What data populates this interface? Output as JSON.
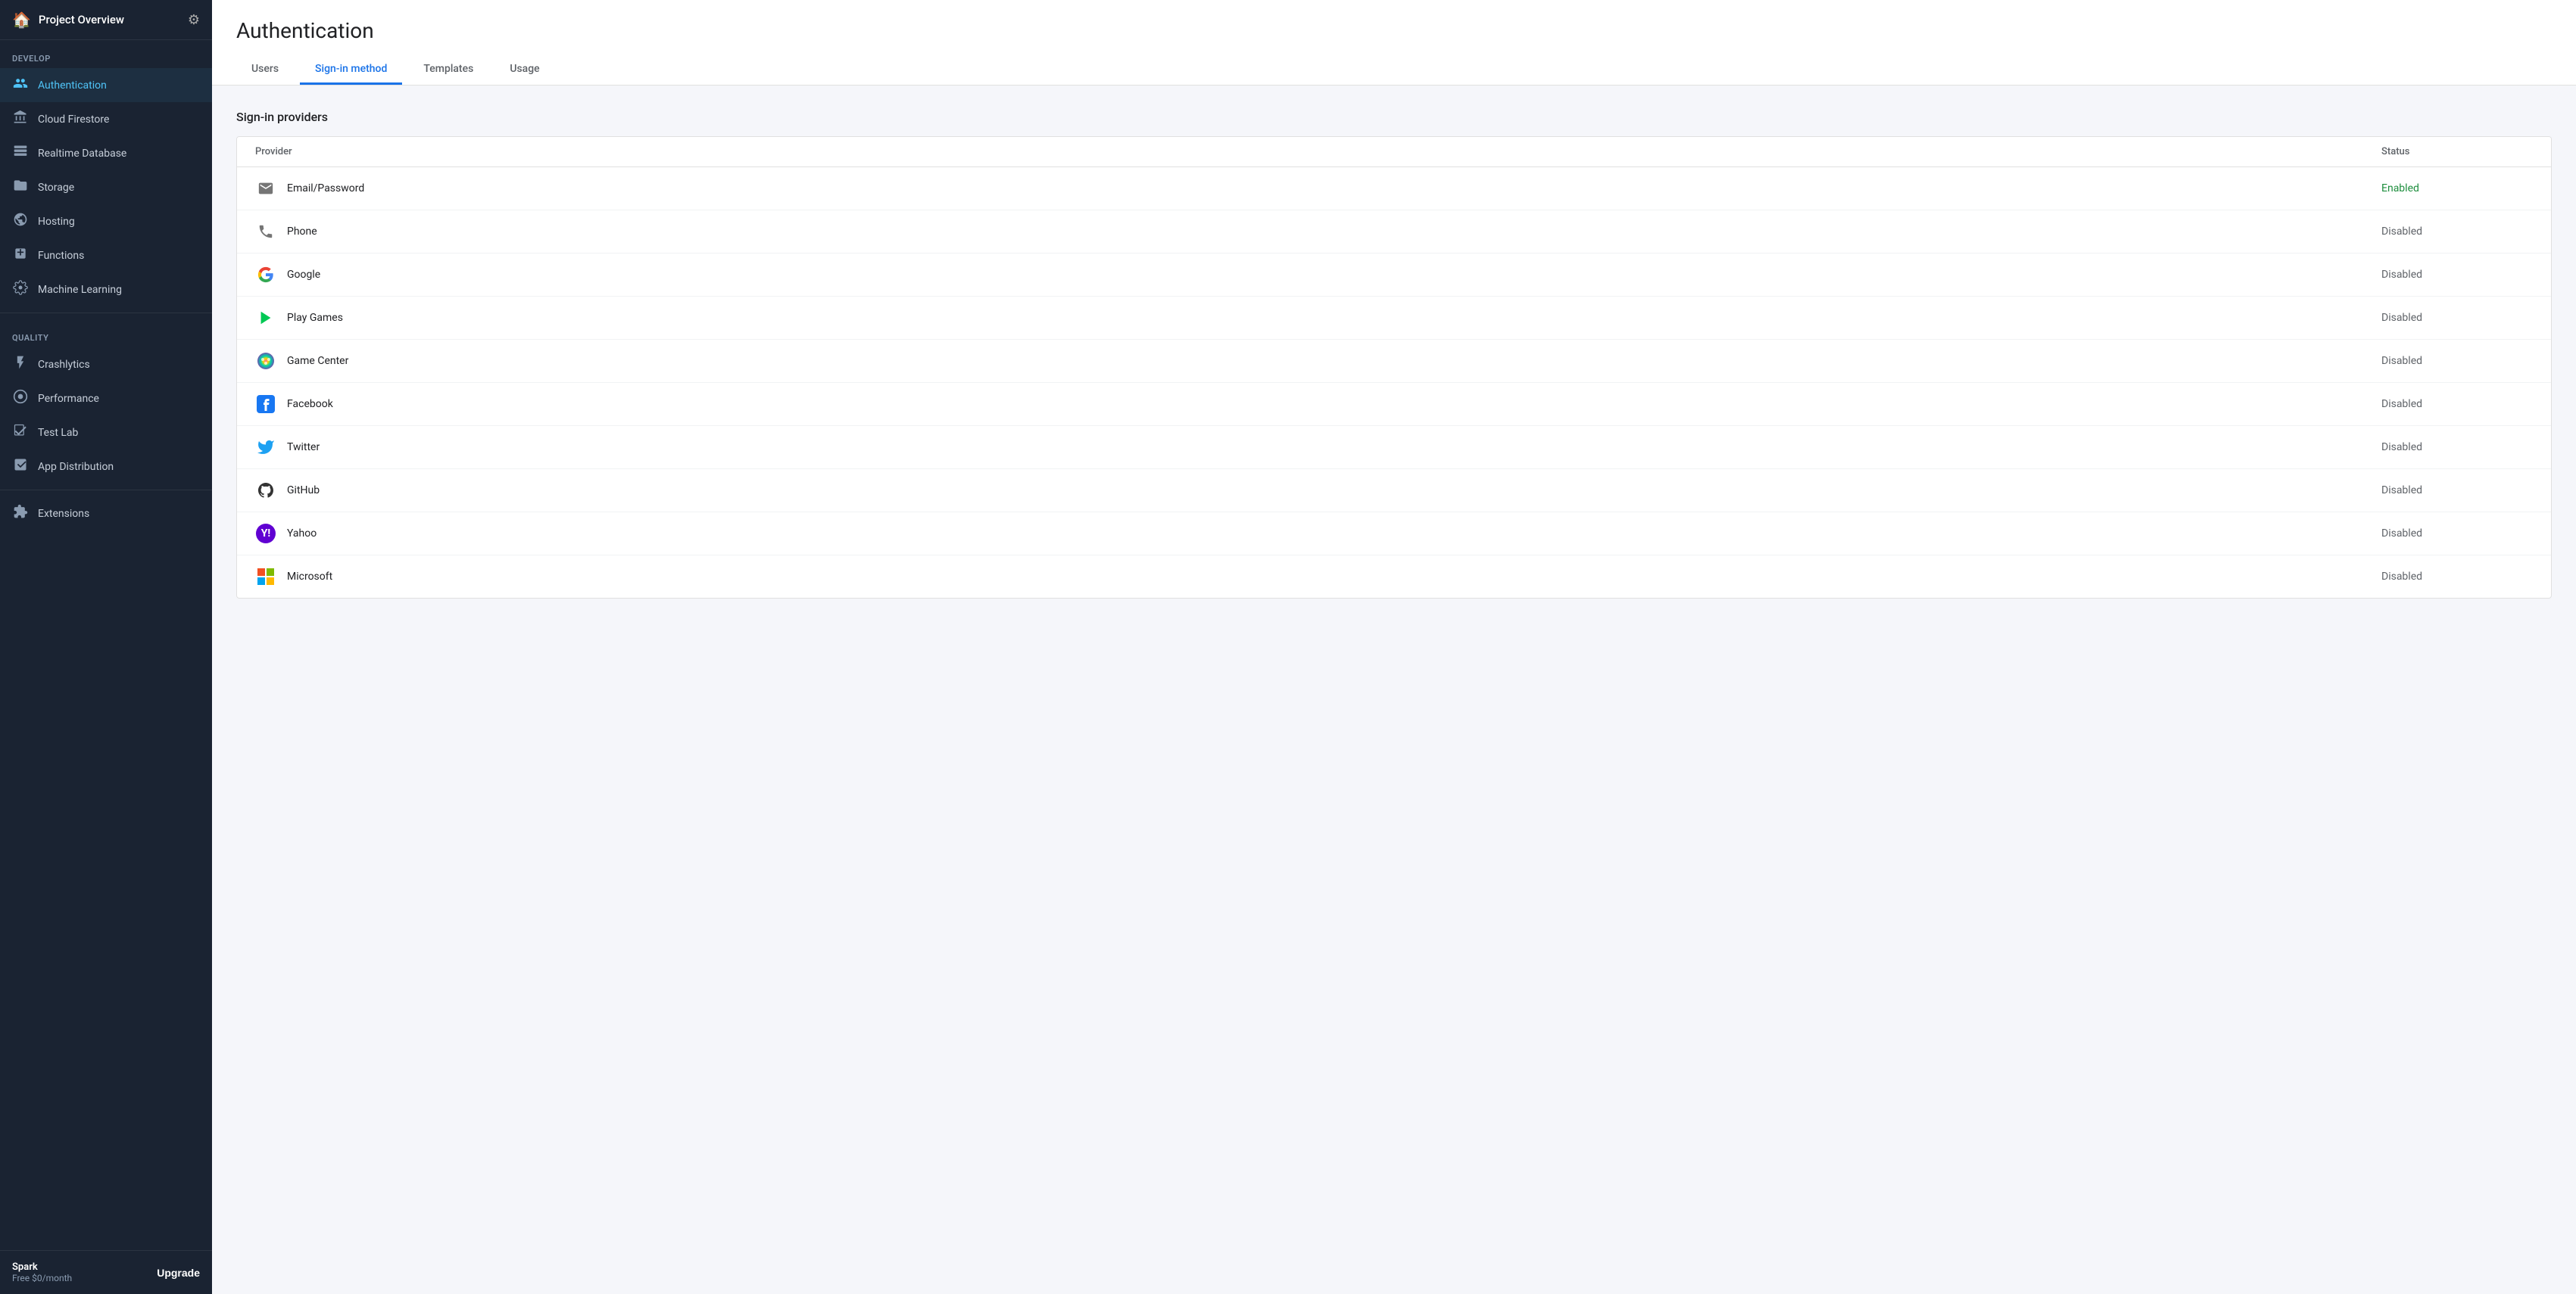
{
  "sidebar": {
    "header": {
      "home_label": "Project Overview",
      "gear_label": "⚙"
    },
    "develop": {
      "section_label": "Develop",
      "items": [
        {
          "id": "authentication",
          "label": "Authentication",
          "icon": "👥",
          "active": true
        },
        {
          "id": "cloud-firestore",
          "label": "Cloud Firestore",
          "icon": "🔥"
        },
        {
          "id": "realtime-database",
          "label": "Realtime Database",
          "icon": "🖥"
        },
        {
          "id": "storage",
          "label": "Storage",
          "icon": "🖼"
        },
        {
          "id": "hosting",
          "label": "Hosting",
          "icon": "🌐"
        },
        {
          "id": "functions",
          "label": "Functions",
          "icon": "⚙"
        },
        {
          "id": "machine-learning",
          "label": "Machine Learning",
          "icon": "🤖"
        }
      ]
    },
    "quality": {
      "section_label": "Quality",
      "items": [
        {
          "id": "crashlytics",
          "label": "Crashlytics",
          "icon": "⚡"
        },
        {
          "id": "performance",
          "label": "Performance",
          "icon": "🔘"
        },
        {
          "id": "test-lab",
          "label": "Test Lab",
          "icon": "✅"
        },
        {
          "id": "app-distribution",
          "label": "App Distribution",
          "icon": "📋"
        }
      ]
    },
    "extensions": {
      "label": "Extensions",
      "icon": "🧩"
    },
    "footer": {
      "plan_name": "Spark",
      "plan_price": "Free $0/month",
      "upgrade_label": "Upgrade"
    }
  },
  "header": {
    "page_title": "Authentication",
    "tabs": [
      {
        "id": "users",
        "label": "Users",
        "active": false
      },
      {
        "id": "sign-in-method",
        "label": "Sign-in method",
        "active": true
      },
      {
        "id": "templates",
        "label": "Templates",
        "active": false
      },
      {
        "id": "usage",
        "label": "Usage",
        "active": false
      }
    ]
  },
  "content": {
    "section_title": "Sign-in providers",
    "table": {
      "columns": [
        {
          "id": "provider",
          "label": "Provider"
        },
        {
          "id": "status",
          "label": "Status"
        }
      ],
      "rows": [
        {
          "id": "email-password",
          "provider": "Email/Password",
          "icon_type": "email",
          "status": "Enabled",
          "enabled": true
        },
        {
          "id": "phone",
          "provider": "Phone",
          "icon_type": "phone",
          "status": "Disabled",
          "enabled": false
        },
        {
          "id": "google",
          "provider": "Google",
          "icon_type": "google",
          "status": "Disabled",
          "enabled": false
        },
        {
          "id": "play-games",
          "provider": "Play Games",
          "icon_type": "play-games",
          "status": "Disabled",
          "enabled": false
        },
        {
          "id": "game-center",
          "provider": "Game Center",
          "icon_type": "game-center",
          "status": "Disabled",
          "enabled": false
        },
        {
          "id": "facebook",
          "provider": "Facebook",
          "icon_type": "facebook",
          "status": "Disabled",
          "enabled": false
        },
        {
          "id": "twitter",
          "provider": "Twitter",
          "icon_type": "twitter",
          "status": "Disabled",
          "enabled": false
        },
        {
          "id": "github",
          "provider": "GitHub",
          "icon_type": "github",
          "status": "Disabled",
          "enabled": false
        },
        {
          "id": "yahoo",
          "provider": "Yahoo",
          "icon_type": "yahoo",
          "status": "Disabled",
          "enabled": false
        },
        {
          "id": "microsoft",
          "provider": "Microsoft",
          "icon_type": "microsoft",
          "status": "Disabled",
          "enabled": false
        }
      ]
    }
  }
}
